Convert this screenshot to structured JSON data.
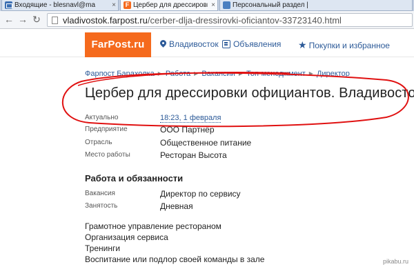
{
  "browser": {
    "tabs": [
      {
        "title": "Входящие - blesnavl@ma",
        "icon": "mail-icon",
        "active": false
      },
      {
        "title": "Цербер для дрессировки",
        "icon": "farpost-favicon",
        "active": true
      },
      {
        "title": "Персональный раздел |",
        "icon": "page-icon",
        "active": false
      }
    ],
    "url_host": "vladivostok.farpost.ru",
    "url_path": "/cerber-dlja-dressirovki-oficiantov-33723140.html"
  },
  "header": {
    "logo": "FarPost.ru",
    "nav": [
      {
        "label": "Владивосток",
        "icon": "location-pin-icon"
      },
      {
        "label": "Объявления",
        "icon": "listings-icon"
      },
      {
        "label": "Покупки и избранное",
        "icon": "star-icon"
      }
    ]
  },
  "breadcrumbs": [
    "Фарпост Барахолка",
    "Работа",
    "Вакансии",
    "Топ-менеджмент",
    "Директор"
  ],
  "title": "Цербер для дрессировки официантов. Владивосток",
  "details": [
    {
      "label": "Актуально",
      "value": "18:23, 1 февраля",
      "link": true
    },
    {
      "label": "Предприятие",
      "value": "ООО Партнёр",
      "link": false
    },
    {
      "label": "Отрасль",
      "value": "Общественное питание",
      "link": false
    },
    {
      "label": "Место работы",
      "value": "Ресторан Высота",
      "link": false
    }
  ],
  "duties": {
    "heading": "Работа и обязанности",
    "rows": [
      {
        "label": "Вакансия",
        "value": "Директор по сервису"
      },
      {
        "label": "Занятость",
        "value": "Дневная"
      }
    ],
    "lines": [
      "Грамотное управление рестораном",
      "Организация сервиса",
      "Тренинги",
      "Воспитание или подлор своей команды в зале"
    ]
  },
  "watermark": "pikabu.ru",
  "colors": {
    "brand": "#f56a1d",
    "link": "#2c5a98",
    "annotation": "#e01010"
  }
}
